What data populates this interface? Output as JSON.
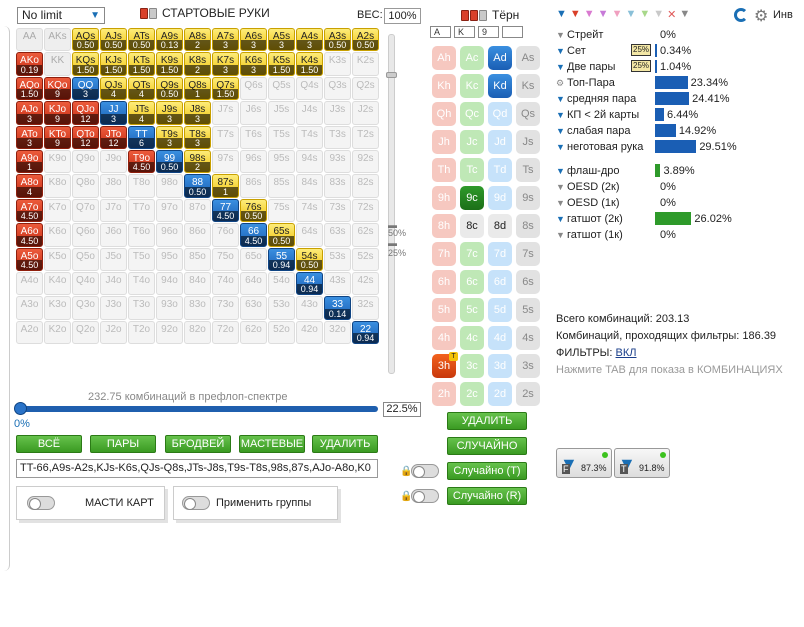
{
  "left": {
    "limit_value": "No limit",
    "title": "СТАРТОВЫЕ РУКИ",
    "weight_label": "ВЕС:",
    "weight_value": "100%",
    "grid": [
      [
        {
          "h": "AA",
          "c": "g"
        },
        {
          "h": "AKs",
          "c": "g"
        },
        {
          "h": "AQs",
          "c": "y",
          "f": "0.50"
        },
        {
          "h": "AJs",
          "c": "y",
          "f": "0.50"
        },
        {
          "h": "ATs",
          "c": "y",
          "f": "0.50"
        },
        {
          "h": "A9s",
          "c": "y",
          "f": "0.13"
        },
        {
          "h": "A8s",
          "c": "y",
          "f": "2"
        },
        {
          "h": "A7s",
          "c": "y",
          "f": "3"
        },
        {
          "h": "A6s",
          "c": "y",
          "f": "3"
        },
        {
          "h": "A5s",
          "c": "y",
          "f": "3"
        },
        {
          "h": "A4s",
          "c": "y",
          "f": "3"
        },
        {
          "h": "A3s",
          "c": "y",
          "f": "0.50"
        },
        {
          "h": "A2s",
          "c": "y",
          "f": "0.50"
        }
      ],
      [
        {
          "h": "AKo",
          "c": "r",
          "f": "0.19"
        },
        {
          "h": "KK",
          "c": "g"
        },
        {
          "h": "KQs",
          "c": "y",
          "f": "1.50"
        },
        {
          "h": "KJs",
          "c": "y",
          "f": "1.50"
        },
        {
          "h": "KTs",
          "c": "y",
          "f": "1.50"
        },
        {
          "h": "K9s",
          "c": "y",
          "f": "1.50"
        },
        {
          "h": "K8s",
          "c": "y",
          "f": "2"
        },
        {
          "h": "K7s",
          "c": "y",
          "f": "3"
        },
        {
          "h": "K6s",
          "c": "y",
          "f": "3"
        },
        {
          "h": "K5s",
          "c": "y",
          "f": "1.50"
        },
        {
          "h": "K4s",
          "c": "y",
          "f": "1.50"
        },
        {
          "h": "K3s",
          "c": "w"
        },
        {
          "h": "K2s",
          "c": "w"
        }
      ],
      [
        {
          "h": "AQo",
          "c": "r",
          "f": "1.50"
        },
        {
          "h": "KQo",
          "c": "r",
          "f": "9"
        },
        {
          "h": "QQ",
          "c": "b",
          "f": "3"
        },
        {
          "h": "QJs",
          "c": "y",
          "f": "4"
        },
        {
          "h": "QTs",
          "c": "y",
          "f": "4"
        },
        {
          "h": "Q9s",
          "c": "y",
          "f": "0.50"
        },
        {
          "h": "Q8s",
          "c": "y",
          "f": "1"
        },
        {
          "h": "Q7s",
          "c": "y",
          "f": "1.50"
        },
        {
          "h": "Q6s",
          "c": "w"
        },
        {
          "h": "Q5s",
          "c": "w"
        },
        {
          "h": "Q4s",
          "c": "w"
        },
        {
          "h": "Q3s",
          "c": "w"
        },
        {
          "h": "Q2s",
          "c": "w"
        }
      ],
      [
        {
          "h": "AJo",
          "c": "r",
          "f": "3"
        },
        {
          "h": "KJo",
          "c": "r",
          "f": "9"
        },
        {
          "h": "QJo",
          "c": "r",
          "f": "12"
        },
        {
          "h": "JJ",
          "c": "b",
          "f": "3"
        },
        {
          "h": "JTs",
          "c": "y",
          "f": "4"
        },
        {
          "h": "J9s",
          "c": "y",
          "f": "3"
        },
        {
          "h": "J8s",
          "c": "y",
          "f": "3"
        },
        {
          "h": "J7s",
          "c": "w"
        },
        {
          "h": "J6s",
          "c": "w"
        },
        {
          "h": "J5s",
          "c": "w"
        },
        {
          "h": "J4s",
          "c": "w"
        },
        {
          "h": "J3s",
          "c": "w"
        },
        {
          "h": "J2s",
          "c": "w"
        }
      ],
      [
        {
          "h": "ATo",
          "c": "r",
          "f": "3"
        },
        {
          "h": "KTo",
          "c": "r",
          "f": "9"
        },
        {
          "h": "QTo",
          "c": "r",
          "f": "12"
        },
        {
          "h": "JTo",
          "c": "r",
          "f": "12"
        },
        {
          "h": "TT",
          "c": "b",
          "f": "6"
        },
        {
          "h": "T9s",
          "c": "y",
          "f": "3"
        },
        {
          "h": "T8s",
          "c": "y",
          "f": "3"
        },
        {
          "h": "T7s",
          "c": "w"
        },
        {
          "h": "T6s",
          "c": "w"
        },
        {
          "h": "T5s",
          "c": "w"
        },
        {
          "h": "T4s",
          "c": "w"
        },
        {
          "h": "T3s",
          "c": "w"
        },
        {
          "h": "T2s",
          "c": "w"
        }
      ],
      [
        {
          "h": "A9o",
          "c": "r",
          "f": "1"
        },
        {
          "h": "K9o",
          "c": "w"
        },
        {
          "h": "Q9o",
          "c": "w"
        },
        {
          "h": "J9o",
          "c": "w"
        },
        {
          "h": "T9o",
          "c": "r",
          "f": "4.50"
        },
        {
          "h": "99",
          "c": "b",
          "f": "0.50"
        },
        {
          "h": "98s",
          "c": "y",
          "f": "2"
        },
        {
          "h": "97s",
          "c": "w"
        },
        {
          "h": "96s",
          "c": "w"
        },
        {
          "h": "95s",
          "c": "w"
        },
        {
          "h": "94s",
          "c": "w"
        },
        {
          "h": "93s",
          "c": "w"
        },
        {
          "h": "92s",
          "c": "w"
        }
      ],
      [
        {
          "h": "A8o",
          "c": "r",
          "f": "4"
        },
        {
          "h": "K8o",
          "c": "w"
        },
        {
          "h": "Q8o",
          "c": "w"
        },
        {
          "h": "J8o",
          "c": "w"
        },
        {
          "h": "T8o",
          "c": "w"
        },
        {
          "h": "98o",
          "c": "w"
        },
        {
          "h": "88",
          "c": "b",
          "f": "0.50"
        },
        {
          "h": "87s",
          "c": "y",
          "f": "1"
        },
        {
          "h": "86s",
          "c": "w"
        },
        {
          "h": "85s",
          "c": "w"
        },
        {
          "h": "84s",
          "c": "w"
        },
        {
          "h": "83s",
          "c": "w"
        },
        {
          "h": "82s",
          "c": "w"
        }
      ],
      [
        {
          "h": "A7o",
          "c": "r",
          "f": "4.50"
        },
        {
          "h": "K7o",
          "c": "w"
        },
        {
          "h": "Q7o",
          "c": "w"
        },
        {
          "h": "J7o",
          "c": "w"
        },
        {
          "h": "T7o",
          "c": "w"
        },
        {
          "h": "97o",
          "c": "w"
        },
        {
          "h": "87o",
          "c": "w"
        },
        {
          "h": "77",
          "c": "b",
          "f": "4.50"
        },
        {
          "h": "76s",
          "c": "y",
          "f": "0.50"
        },
        {
          "h": "75s",
          "c": "w"
        },
        {
          "h": "74s",
          "c": "w"
        },
        {
          "h": "73s",
          "c": "w"
        },
        {
          "h": "72s",
          "c": "w"
        }
      ],
      [
        {
          "h": "A6o",
          "c": "r",
          "f": "4.50"
        },
        {
          "h": "K6o",
          "c": "w"
        },
        {
          "h": "Q6o",
          "c": "w"
        },
        {
          "h": "J6o",
          "c": "w"
        },
        {
          "h": "T6o",
          "c": "w"
        },
        {
          "h": "96o",
          "c": "w"
        },
        {
          "h": "86o",
          "c": "w"
        },
        {
          "h": "76o",
          "c": "w"
        },
        {
          "h": "66",
          "c": "b",
          "f": "4.50"
        },
        {
          "h": "65s",
          "c": "y",
          "f": "0.50"
        },
        {
          "h": "64s",
          "c": "w"
        },
        {
          "h": "63s",
          "c": "w"
        },
        {
          "h": "62s",
          "c": "w"
        }
      ],
      [
        {
          "h": "A5o",
          "c": "r",
          "f": "4.50"
        },
        {
          "h": "K5o",
          "c": "w"
        },
        {
          "h": "Q5o",
          "c": "w"
        },
        {
          "h": "J5o",
          "c": "w"
        },
        {
          "h": "T5o",
          "c": "w"
        },
        {
          "h": "95o",
          "c": "w"
        },
        {
          "h": "85o",
          "c": "w"
        },
        {
          "h": "75o",
          "c": "w"
        },
        {
          "h": "65o",
          "c": "w"
        },
        {
          "h": "55",
          "c": "b",
          "f": "0.94"
        },
        {
          "h": "54s",
          "c": "y",
          "f": "0.50"
        },
        {
          "h": "53s",
          "c": "w"
        },
        {
          "h": "52s",
          "c": "w"
        }
      ],
      [
        {
          "h": "A4o",
          "c": "w"
        },
        {
          "h": "K4o",
          "c": "w"
        },
        {
          "h": "Q4o",
          "c": "w"
        },
        {
          "h": "J4o",
          "c": "w"
        },
        {
          "h": "T4o",
          "c": "w"
        },
        {
          "h": "94o",
          "c": "w"
        },
        {
          "h": "84o",
          "c": "w"
        },
        {
          "h": "74o",
          "c": "w"
        },
        {
          "h": "64o",
          "c": "w"
        },
        {
          "h": "54o",
          "c": "w"
        },
        {
          "h": "44",
          "c": "b",
          "f": "0.94"
        },
        {
          "h": "43s",
          "c": "w"
        },
        {
          "h": "42s",
          "c": "w"
        }
      ],
      [
        {
          "h": "A3o",
          "c": "w"
        },
        {
          "h": "K3o",
          "c": "w"
        },
        {
          "h": "Q3o",
          "c": "w"
        },
        {
          "h": "J3o",
          "c": "w"
        },
        {
          "h": "T3o",
          "c": "w"
        },
        {
          "h": "93o",
          "c": "w"
        },
        {
          "h": "83o",
          "c": "w"
        },
        {
          "h": "73o",
          "c": "w"
        },
        {
          "h": "63o",
          "c": "w"
        },
        {
          "h": "53o",
          "c": "w"
        },
        {
          "h": "43o",
          "c": "w"
        },
        {
          "h": "33",
          "c": "b",
          "f": "0.14"
        },
        {
          "h": "32s",
          "c": "w"
        }
      ],
      [
        {
          "h": "A2o",
          "c": "w"
        },
        {
          "h": "K2o",
          "c": "w"
        },
        {
          "h": "Q2o",
          "c": "w"
        },
        {
          "h": "J2o",
          "c": "w"
        },
        {
          "h": "T2o",
          "c": "w"
        },
        {
          "h": "92o",
          "c": "w"
        },
        {
          "h": "82o",
          "c": "w"
        },
        {
          "h": "72o",
          "c": "w"
        },
        {
          "h": "62o",
          "c": "w"
        },
        {
          "h": "52o",
          "c": "w"
        },
        {
          "h": "42o",
          "c": "w"
        },
        {
          "h": "32o",
          "c": "w"
        },
        {
          "h": "22",
          "c": "b",
          "f": "0.94"
        }
      ]
    ],
    "vslider_label_1": "50%",
    "vslider_label_2": "25%",
    "combos_text": "232.75 комбинаций в префлоп-спектре",
    "range_pct": "22.5%",
    "range_min": "0%",
    "buttons": {
      "all": "ВСЁ",
      "pairs": "ПАРЫ",
      "broadways": "БРОДВЕЙ",
      "suited": "МАСТЕВЫЕ",
      "delete": "УДАЛИТЬ"
    },
    "range_text": "TT-66,A9s-A2s,KJs-K6s,QJs-Q8s,JTs-J8s,T9s-T8s,98s,87s,AJo-A8o,K0",
    "suits_toggle_label": "МАСТИ КАРТ",
    "groups_toggle_label": "Применить группы"
  },
  "turn": {
    "title": "Тёрн",
    "slots": [
      "A",
      "K",
      "9",
      ""
    ],
    "columns": [
      [
        {
          "l": "Ah",
          "s": "h"
        },
        {
          "l": "Kh",
          "s": "h"
        },
        {
          "l": "Qh",
          "s": "h"
        },
        {
          "l": "Jh",
          "s": "h"
        },
        {
          "l": "Th",
          "s": "h"
        },
        {
          "l": "9h",
          "s": "h"
        },
        {
          "l": "8h",
          "s": "h"
        },
        {
          "l": "7h",
          "s": "h"
        },
        {
          "l": "6h",
          "s": "h"
        },
        {
          "l": "5h",
          "s": "h"
        },
        {
          "l": "4h",
          "s": "h"
        },
        {
          "l": "3h",
          "s": "on-h",
          "badge": "T"
        },
        {
          "l": "2h",
          "s": "h"
        }
      ],
      [
        {
          "l": "Ac",
          "s": "c"
        },
        {
          "l": "Kc",
          "s": "c"
        },
        {
          "l": "Qc",
          "s": "c"
        },
        {
          "l": "Jc",
          "s": "c"
        },
        {
          "l": "Tc",
          "s": "c"
        },
        {
          "l": "9c",
          "s": "on-c"
        },
        {
          "l": "8c",
          "s": "blank"
        },
        {
          "l": "7c",
          "s": "c"
        },
        {
          "l": "6c",
          "s": "c"
        },
        {
          "l": "5c",
          "s": "c"
        },
        {
          "l": "4c",
          "s": "c"
        },
        {
          "l": "3c",
          "s": "c"
        },
        {
          "l": "2c",
          "s": "c"
        }
      ],
      [
        {
          "l": "Ad",
          "s": "on-d"
        },
        {
          "l": "Kd",
          "s": "on-d"
        },
        {
          "l": "Qd",
          "s": "d"
        },
        {
          "l": "Jd",
          "s": "d"
        },
        {
          "l": "Td",
          "s": "d"
        },
        {
          "l": "9d",
          "s": "d"
        },
        {
          "l": "8d",
          "s": "blank"
        },
        {
          "l": "7d",
          "s": "d"
        },
        {
          "l": "6d",
          "s": "d"
        },
        {
          "l": "5d",
          "s": "d"
        },
        {
          "l": "4d",
          "s": "d"
        },
        {
          "l": "3d",
          "s": "d"
        },
        {
          "l": "2d",
          "s": "d"
        }
      ],
      [
        {
          "l": "As",
          "s": "s"
        },
        {
          "l": "Ks",
          "s": "s"
        },
        {
          "l": "Qs",
          "s": "s"
        },
        {
          "l": "Js",
          "s": "s"
        },
        {
          "l": "Ts",
          "s": "s"
        },
        {
          "l": "9s",
          "s": "s"
        },
        {
          "l": "8s",
          "s": "s"
        },
        {
          "l": "7s",
          "s": "s"
        },
        {
          "l": "6s",
          "s": "s"
        },
        {
          "l": "5s",
          "s": "s"
        },
        {
          "l": "4s",
          "s": "s"
        },
        {
          "l": "3s",
          "s": "s"
        },
        {
          "l": "2s",
          "s": "s"
        }
      ]
    ],
    "btn_delete": "УДАЛИТЬ",
    "btn_random": "СЛУЧАЙНО",
    "btn_random_t": "Случайно (T)",
    "btn_random_r": "Случайно (R)"
  },
  "filters": {
    "inv_label": "Инв",
    "rows": [
      {
        "name": "Стрейт",
        "value": "0%",
        "pct": 0,
        "funnel": "gray"
      },
      {
        "name": "Сет",
        "value": "0.34%",
        "pct": 0.34,
        "funnel": "blue",
        "chip": "25%"
      },
      {
        "name": "Две пары",
        "value": "1.04%",
        "pct": 1.04,
        "funnel": "blue",
        "chip": "25%"
      },
      {
        "name": "Топ-Пара",
        "value": "23.34%",
        "pct": 23.34,
        "funnel": "gear"
      },
      {
        "name": "средняя пара",
        "value": "24.41%",
        "pct": 24.41,
        "funnel": "blue"
      },
      {
        "name": "КП < 2й карты",
        "value": "6.44%",
        "pct": 6.44,
        "funnel": "blue"
      },
      {
        "name": "слабая пара",
        "value": "14.92%",
        "pct": 14.92,
        "funnel": "blue"
      },
      {
        "name": "неготовая рука",
        "value": "29.51%",
        "pct": 29.51,
        "funnel": "blue"
      },
      {
        "name": "флаш-дро",
        "value": "3.89%",
        "pct": 3.89,
        "funnel": "blue",
        "color": "#2e9a2a"
      },
      {
        "name": "OESD (2к)",
        "value": "0%",
        "pct": 0,
        "funnel": "gray"
      },
      {
        "name": "OESD (1к)",
        "value": "0%",
        "pct": 0,
        "funnel": "gray"
      },
      {
        "name": "гатшот (2к)",
        "value": "26.02%",
        "pct": 26.02,
        "funnel": "blue",
        "color": "#2e9a2a"
      },
      {
        "name": "гатшот (1к)",
        "value": "0%",
        "pct": 0,
        "funnel": "gray"
      }
    ],
    "total_label": "Всего комбинаций: 203.13",
    "passing_label": "Комбинаций, проходящих фильтры: 186.39",
    "filters_label": "ФИЛЬТРЫ:",
    "filters_value": "ВКЛ",
    "hint": "Нажмите TAB для показа в КОМБИНАЦИЯХ",
    "badge_f_letter": "F",
    "badge_f_pct": "87.3%",
    "badge_t_letter": "T",
    "badge_t_pct": "91.8%"
  }
}
